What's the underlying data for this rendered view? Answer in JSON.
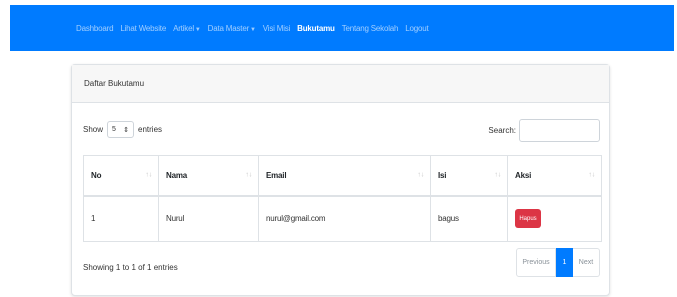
{
  "navbar": {
    "items": [
      {
        "label": "Dashboard",
        "dropdown": false,
        "active": false
      },
      {
        "label": "Lihat Website",
        "dropdown": false,
        "active": false
      },
      {
        "label": "Artikel",
        "dropdown": true,
        "active": false
      },
      {
        "label": "Data Master",
        "dropdown": true,
        "active": false
      },
      {
        "label": "Visi Misi",
        "dropdown": false,
        "active": false
      },
      {
        "label": "Bukutamu",
        "dropdown": false,
        "active": true
      },
      {
        "label": "Tentang Sekolah",
        "dropdown": false,
        "active": false
      },
      {
        "label": "Logout",
        "dropdown": false,
        "active": false
      }
    ],
    "background": "#007bff"
  },
  "card": {
    "header": "Daftar Bukutamu"
  },
  "controls": {
    "show_label": "Show",
    "entries_value": "5",
    "entries_label": "entries",
    "search_label": "Search:",
    "search_value": ""
  },
  "table": {
    "headers": [
      "No",
      "Nama",
      "Email",
      "Isi",
      "Aksi"
    ],
    "rows": [
      {
        "no": "1",
        "nama": "Nurul",
        "email": "nurul@gmail.com",
        "isi": "bagus",
        "action": "Hapus"
      }
    ]
  },
  "footer": {
    "info": "Showing 1 to 1 of 1 entries",
    "prev": "Previous",
    "current": "1",
    "next": "Next"
  },
  "colors": {
    "primary": "#007bff",
    "danger": "#dc3545"
  }
}
